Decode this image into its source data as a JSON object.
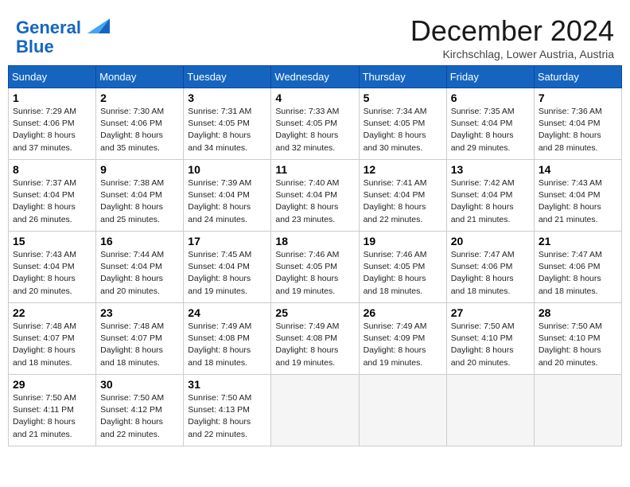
{
  "header": {
    "logo_line1": "General",
    "logo_line2": "Blue",
    "month_title": "December 2024",
    "subtitle": "Kirchschlag, Lower Austria, Austria"
  },
  "weekdays": [
    "Sunday",
    "Monday",
    "Tuesday",
    "Wednesday",
    "Thursday",
    "Friday",
    "Saturday"
  ],
  "weeks": [
    [
      {
        "day": "1",
        "info": "Sunrise: 7:29 AM\nSunset: 4:06 PM\nDaylight: 8 hours and 37 minutes."
      },
      {
        "day": "2",
        "info": "Sunrise: 7:30 AM\nSunset: 4:06 PM\nDaylight: 8 hours and 35 minutes."
      },
      {
        "day": "3",
        "info": "Sunrise: 7:31 AM\nSunset: 4:05 PM\nDaylight: 8 hours and 34 minutes."
      },
      {
        "day": "4",
        "info": "Sunrise: 7:33 AM\nSunset: 4:05 PM\nDaylight: 8 hours and 32 minutes."
      },
      {
        "day": "5",
        "info": "Sunrise: 7:34 AM\nSunset: 4:05 PM\nDaylight: 8 hours and 30 minutes."
      },
      {
        "day": "6",
        "info": "Sunrise: 7:35 AM\nSunset: 4:04 PM\nDaylight: 8 hours and 29 minutes."
      },
      {
        "day": "7",
        "info": "Sunrise: 7:36 AM\nSunset: 4:04 PM\nDaylight: 8 hours and 28 minutes."
      }
    ],
    [
      {
        "day": "8",
        "info": "Sunrise: 7:37 AM\nSunset: 4:04 PM\nDaylight: 8 hours and 26 minutes."
      },
      {
        "day": "9",
        "info": "Sunrise: 7:38 AM\nSunset: 4:04 PM\nDaylight: 8 hours and 25 minutes."
      },
      {
        "day": "10",
        "info": "Sunrise: 7:39 AM\nSunset: 4:04 PM\nDaylight: 8 hours and 24 minutes."
      },
      {
        "day": "11",
        "info": "Sunrise: 7:40 AM\nSunset: 4:04 PM\nDaylight: 8 hours and 23 minutes."
      },
      {
        "day": "12",
        "info": "Sunrise: 7:41 AM\nSunset: 4:04 PM\nDaylight: 8 hours and 22 minutes."
      },
      {
        "day": "13",
        "info": "Sunrise: 7:42 AM\nSunset: 4:04 PM\nDaylight: 8 hours and 21 minutes."
      },
      {
        "day": "14",
        "info": "Sunrise: 7:43 AM\nSunset: 4:04 PM\nDaylight: 8 hours and 21 minutes."
      }
    ],
    [
      {
        "day": "15",
        "info": "Sunrise: 7:43 AM\nSunset: 4:04 PM\nDaylight: 8 hours and 20 minutes."
      },
      {
        "day": "16",
        "info": "Sunrise: 7:44 AM\nSunset: 4:04 PM\nDaylight: 8 hours and 20 minutes."
      },
      {
        "day": "17",
        "info": "Sunrise: 7:45 AM\nSunset: 4:04 PM\nDaylight: 8 hours and 19 minutes."
      },
      {
        "day": "18",
        "info": "Sunrise: 7:46 AM\nSunset: 4:05 PM\nDaylight: 8 hours and 19 minutes."
      },
      {
        "day": "19",
        "info": "Sunrise: 7:46 AM\nSunset: 4:05 PM\nDaylight: 8 hours and 18 minutes."
      },
      {
        "day": "20",
        "info": "Sunrise: 7:47 AM\nSunset: 4:06 PM\nDaylight: 8 hours and 18 minutes."
      },
      {
        "day": "21",
        "info": "Sunrise: 7:47 AM\nSunset: 4:06 PM\nDaylight: 8 hours and 18 minutes."
      }
    ],
    [
      {
        "day": "22",
        "info": "Sunrise: 7:48 AM\nSunset: 4:07 PM\nDaylight: 8 hours and 18 minutes."
      },
      {
        "day": "23",
        "info": "Sunrise: 7:48 AM\nSunset: 4:07 PM\nDaylight: 8 hours and 18 minutes."
      },
      {
        "day": "24",
        "info": "Sunrise: 7:49 AM\nSunset: 4:08 PM\nDaylight: 8 hours and 18 minutes."
      },
      {
        "day": "25",
        "info": "Sunrise: 7:49 AM\nSunset: 4:08 PM\nDaylight: 8 hours and 19 minutes."
      },
      {
        "day": "26",
        "info": "Sunrise: 7:49 AM\nSunset: 4:09 PM\nDaylight: 8 hours and 19 minutes."
      },
      {
        "day": "27",
        "info": "Sunrise: 7:50 AM\nSunset: 4:10 PM\nDaylight: 8 hours and 20 minutes."
      },
      {
        "day": "28",
        "info": "Sunrise: 7:50 AM\nSunset: 4:10 PM\nDaylight: 8 hours and 20 minutes."
      }
    ],
    [
      {
        "day": "29",
        "info": "Sunrise: 7:50 AM\nSunset: 4:11 PM\nDaylight: 8 hours and 21 minutes."
      },
      {
        "day": "30",
        "info": "Sunrise: 7:50 AM\nSunset: 4:12 PM\nDaylight: 8 hours and 22 minutes."
      },
      {
        "day": "31",
        "info": "Sunrise: 7:50 AM\nSunset: 4:13 PM\nDaylight: 8 hours and 22 minutes."
      },
      null,
      null,
      null,
      null
    ]
  ]
}
